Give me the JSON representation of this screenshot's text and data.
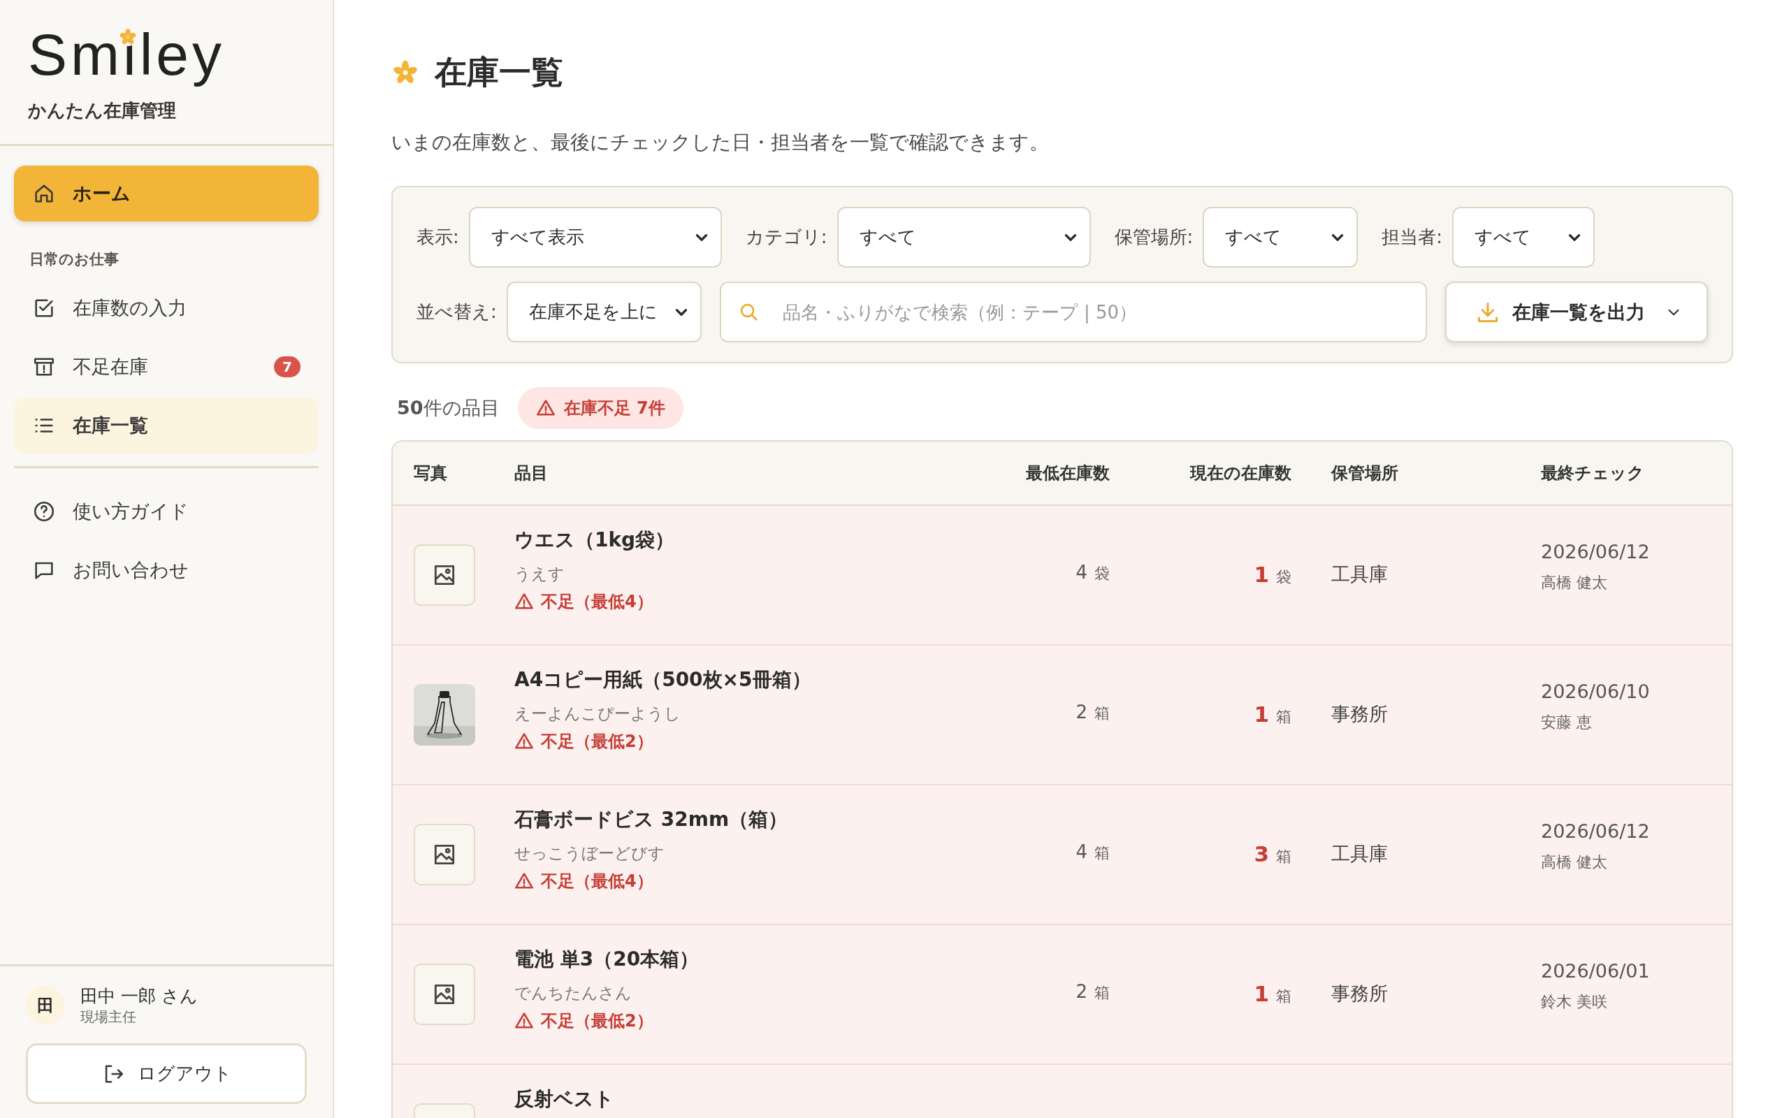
{
  "sidebar": {
    "logo": "Smiley",
    "subtitle": "かんたん在庫管理",
    "home_button": {
      "label": "ホーム"
    },
    "section_label": "日常のお仕事",
    "nav_items": [
      {
        "label": "在庫数の入力",
        "selected": false
      },
      {
        "label": "不足在庫",
        "selected": false,
        "badge": "7"
      },
      {
        "label": "在庫一覧",
        "selected": true
      }
    ],
    "help_items": [
      {
        "label": "使い方ガイド"
      },
      {
        "label": "お問い合わせ"
      }
    ],
    "user": {
      "avatar": "田",
      "name": "田中 一郎 さん",
      "role": "現場主任"
    },
    "logout_button": "ログアウト"
  },
  "page": {
    "title": "在庫一覧",
    "description": "いまの在庫数と、最後にチェックした日・担当者を一覧で確認できます。"
  },
  "filters": {
    "selects": [
      {
        "label": "表示:",
        "value": "すべて表示"
      },
      {
        "label": "カテゴリ:",
        "value": "すべて"
      },
      {
        "label": "保管場所:",
        "value": "すべて"
      },
      {
        "label": "担当者:",
        "value": "すべて"
      }
    ],
    "sort": {
      "label": "並べ替え:",
      "value": "在庫不足を上に"
    },
    "search": {
      "placeholder": "品名・ふりがなで検索（例：テープ | 50）"
    },
    "export_button": "在庫一覧を出力"
  },
  "summary": {
    "count": "**50**件の品目",
    "shortage_badge": "在庫不足 7件"
  },
  "table": {
    "columns": [
      "写真",
      "品目",
      "最低在庫数",
      "現在の在庫数",
      "保管場所",
      "最終チェック"
    ],
    "rows": [
      {
        "photo": {
          "kind": "placeholder"
        },
        "name": "ウエス（1kg袋）",
        "reading": "うえす",
        "warning": "不足（最低4）",
        "min": "4",
        "min_unit": "袋",
        "current": "1",
        "current_unit": "袋",
        "shortage": true,
        "location": "工具庫",
        "date": "2026/06/12",
        "person": "高橋 健太"
      },
      {
        "name": "A4コピー用紙（500枚×5冊箱）",
        "reading": "えーよんこぴーようし",
        "warning": "不足（最低2）",
        "min": "2",
        "min_unit": "箱",
        "current": "1",
        "current_unit": "箱",
        "shortage": true,
        "location": "事務所",
        "date": "2026/06/10",
        "person": "安藤 恵"
      },
      {
        "photo": {
          "kind": "placeholder"
        },
        "name": "石膏ボードビス 32mm（箱）",
        "reading": "せっこうぼーどびす",
        "warning": "不足（最低4）",
        "min": "4",
        "min_unit": "箱",
        "current": "3",
        "current_unit": "箱",
        "shortage": true,
        "location": "工具庫",
        "date": "2026/06/12",
        "person": "高橋 健太"
      },
      {
        "photo": {
          "kind": "placeholder"
        },
        "name": "電池 単3（20本箱）",
        "reading": "でんちたんさん",
        "warning": "不足（最低2）",
        "min": "2",
        "min_unit": "箱",
        "current": "1",
        "current_unit": "箱",
        "shortage": true,
        "location": "事務所",
        "date": "2026/06/01",
        "person": "鈴木 美咲"
      },
      {
        "photo": {
          "kind": "placeholder"
        },
        "name": "反射ベスト",
        "shortage": true
      }
    ]
  }
}
